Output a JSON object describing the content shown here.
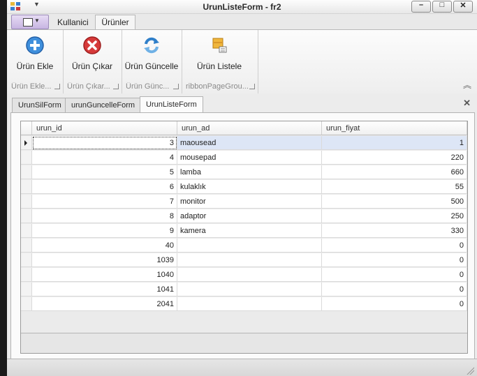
{
  "window": {
    "title": "UrunListeForm - fr2"
  },
  "ribbon": {
    "tabs": [
      {
        "label": "Kullanici"
      },
      {
        "label": "Ürünler"
      }
    ],
    "groups": [
      {
        "button": "Ürün Ekle",
        "caption": "Ürün Ekle...",
        "icon": "add-circle-icon"
      },
      {
        "button": "Ürün Çıkar",
        "caption": "Ürün Çıkar...",
        "icon": "remove-circle-icon"
      },
      {
        "button": "Ürün Güncelle",
        "caption": "Ürün Günc...",
        "icon": "refresh-icon"
      },
      {
        "button": "Ürün Listele",
        "caption": "ribbonPageGrou...",
        "icon": "box-list-icon"
      }
    ]
  },
  "doc_tabs": [
    {
      "label": "UrunSilForm"
    },
    {
      "label": "urunGuncelleForm"
    },
    {
      "label": "UrunListeForm"
    }
  ],
  "grid": {
    "columns": [
      "urun_id",
      "urun_ad",
      "urun_fiyat"
    ],
    "rows": [
      {
        "id": "3",
        "ad": "maousead",
        "fiyat": "1"
      },
      {
        "id": "4",
        "ad": "mousepad",
        "fiyat": "220"
      },
      {
        "id": "5",
        "ad": "lamba",
        "fiyat": "660"
      },
      {
        "id": "6",
        "ad": "kulaklık",
        "fiyat": "55"
      },
      {
        "id": "7",
        "ad": "monitor",
        "fiyat": "500"
      },
      {
        "id": "8",
        "ad": "adaptor",
        "fiyat": "250"
      },
      {
        "id": "9",
        "ad": "kamera",
        "fiyat": "330"
      },
      {
        "id": "40",
        "ad": "",
        "fiyat": "0"
      },
      {
        "id": "1039",
        "ad": "",
        "fiyat": "0"
      },
      {
        "id": "1040",
        "ad": "",
        "fiyat": "0"
      },
      {
        "id": "1041",
        "ad": "",
        "fiyat": "0"
      },
      {
        "id": "2041",
        "ad": "",
        "fiyat": "0"
      }
    ]
  },
  "colors": {
    "selected_row": "#dde6f6",
    "app_menu": "#c7b4e2"
  }
}
